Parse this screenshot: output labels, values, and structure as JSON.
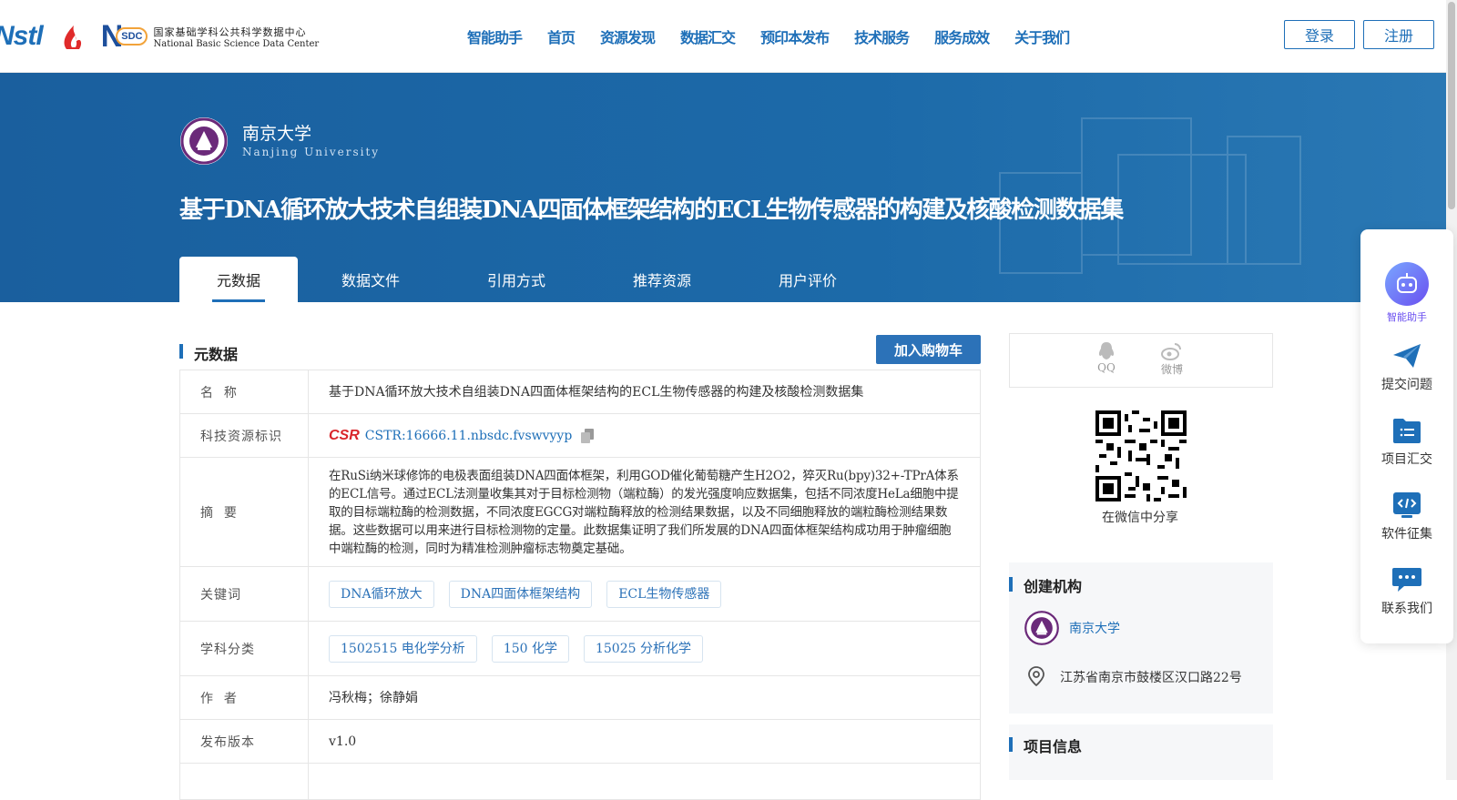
{
  "header": {
    "logos": {
      "nstl": "Nstl",
      "nsdc_short": "SDC",
      "nsdc_cn": "国家基础学科公共科学数据中心",
      "nsdc_en": "National Basic Science Data Center"
    },
    "nav": [
      "智能助手",
      "首页",
      "资源发现",
      "数据汇交",
      "预印本发布",
      "技术服务",
      "服务成效",
      "关于我们"
    ],
    "login": "登录",
    "register": "注册"
  },
  "hero": {
    "university": "南京大学",
    "university_en": "Nanjing University",
    "title": "基于DNA循环放大技术自组装DNA四面体框架结构的ECL生物传感器的构建及核酸检测数据集",
    "tabs": [
      "元数据",
      "数据文件",
      "引用方式",
      "推荐资源",
      "用户评价"
    ]
  },
  "metadata": {
    "section_title": "元数据",
    "cart_button": "加入购物车",
    "rows": [
      {
        "label": "名  称",
        "value": "基于DNA循环放大技术自组装DNA四面体框架结构的ECL生物传感器的构建及核酸检测数据集"
      },
      {
        "label": "科技资源标识",
        "value": "CSTR:16666.11.nbsdc.fvswvyyp"
      },
      {
        "label": "摘  要",
        "value": "在RuSi纳米球修饰的电极表面组装DNA四面体框架，利用GOD催化葡萄糖产生H2O2，猝灭Ru(bpy)32+-TPrA体系的ECL信号。通过ECL法测量收集其对于目标检测物（端粒酶）的发光强度响应数据集，包括不同浓度HeLa细胞中提取的目标端粒酶的检测数据，不同浓度EGCG对端粒酶释放的检测结果数据，以及不同细胞释放的端粒酶检测结果数据。这些数据可以用来进行目标检测物的定量。此数据集证明了我们所发展的DNA四面体框架结构成功用于肿瘤细胞中端粒酶的检测，同时为精准检测肿瘤标志物奠定基础。"
      },
      {
        "label": "关键词",
        "tags": [
          "DNA循环放大",
          "DNA四面体框架结构",
          "ECL生物传感器"
        ]
      },
      {
        "label": "学科分类",
        "tags": [
          "1502515 电化学分析",
          "150 化学",
          "15025 分析化学"
        ]
      },
      {
        "label": "作  者",
        "value": "冯秋梅；徐静娟"
      },
      {
        "label": "发布版本",
        "value": "v1.0"
      }
    ],
    "cstr_logo": "CSR"
  },
  "sidebar": {
    "share": {
      "qq": "QQ",
      "weibo": "微博",
      "wechat": "在微信中分享"
    },
    "org": {
      "title": "创建机构",
      "name": "南京大学",
      "address": "江苏省南京市鼓楼区汉口路22号"
    },
    "project": {
      "title": "项目信息"
    }
  },
  "float_menu": [
    "智能助手",
    "提交问题",
    "项目汇交",
    "软件征集",
    "联系我们"
  ]
}
